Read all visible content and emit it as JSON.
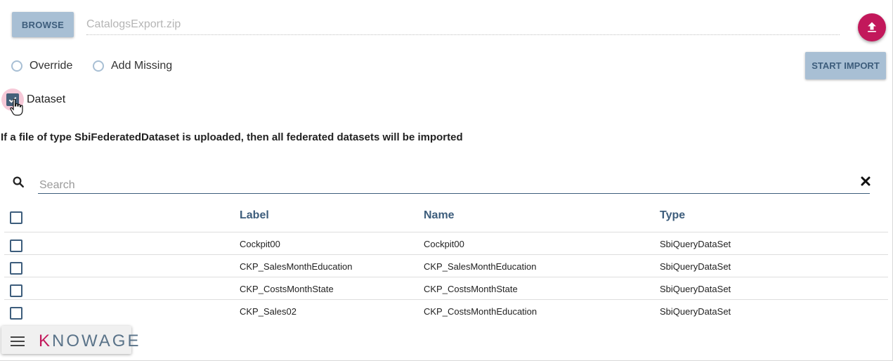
{
  "toolbar": {
    "browse_label": "BROWSE",
    "file_name": "CatalogsExport.zip",
    "upload_icon": "upload-icon",
    "start_import_label": "START IMPORT"
  },
  "options": {
    "override_label": "Override",
    "add_missing_label": "Add Missing",
    "dataset_label": "Dataset",
    "dataset_checked": true
  },
  "info": {
    "message": "If a file of type SbiFederatedDataset is uploaded, then all federated datasets will be imported"
  },
  "search": {
    "placeholder": "Search",
    "value": ""
  },
  "table": {
    "columns": [
      "Label",
      "Name",
      "Type"
    ],
    "rows": [
      {
        "label": "Cockpit00",
        "name": "Cockpit00",
        "type": "SbiQueryDataSet"
      },
      {
        "label": "CKP_SalesMonthEducation",
        "name": "CKP_SalesMonthEducation",
        "type": "SbiQueryDataSet"
      },
      {
        "label": "CKP_CostsMonthState",
        "name": "CKP_CostsMonthState",
        "type": "SbiQueryDataSet"
      },
      {
        "label": "CKP_Sales02",
        "name": "CKP_CostsMonthEducation",
        "type": "SbiQueryDataSet"
      }
    ]
  },
  "footer": {
    "brand_first": "K",
    "brand_rest": "NOWAGE"
  },
  "colors": {
    "accent": "#c2185b",
    "button_bg": "#a8bfd4",
    "primary": "#3d5d7c"
  }
}
